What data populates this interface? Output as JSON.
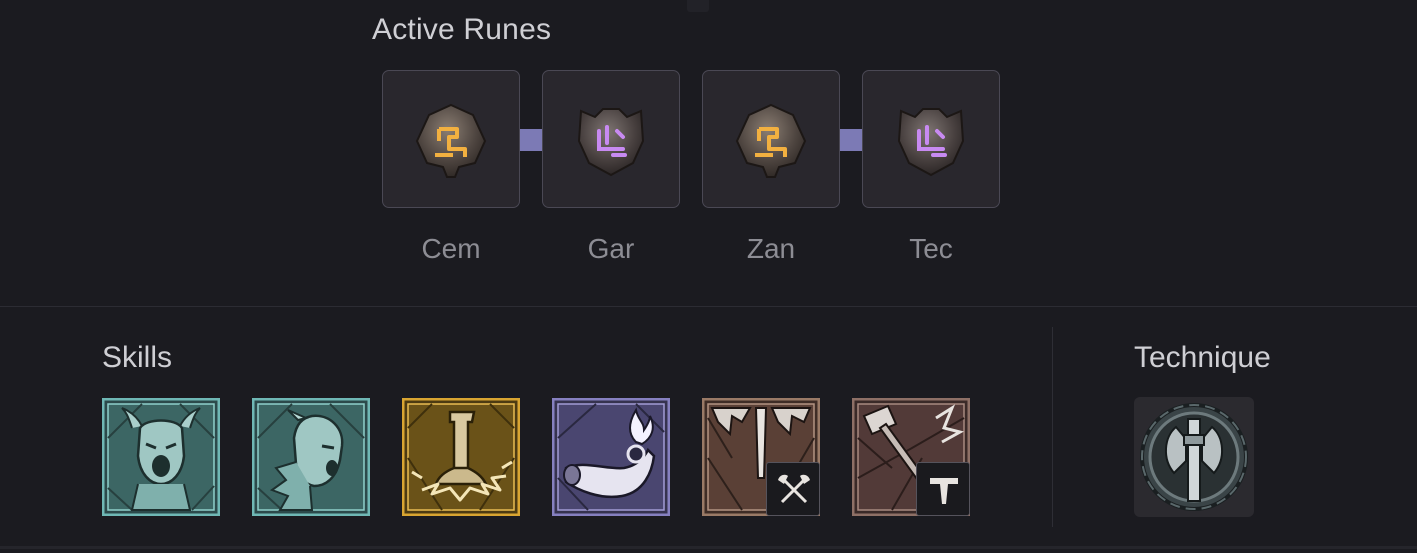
{
  "runes": {
    "title": "Active Runes",
    "slots": [
      {
        "label": "Cem",
        "type": "ritual",
        "glow": "#e8a53a",
        "icon": "rune-cem-icon"
      },
      {
        "label": "Gar",
        "type": "invocation",
        "glow": "#b77ae8",
        "icon": "rune-gar-icon"
      },
      {
        "label": "Zan",
        "type": "ritual",
        "glow": "#e8a53a",
        "icon": "rune-zan-icon"
      },
      {
        "label": "Tec",
        "type": "invocation",
        "glow": "#b77ae8",
        "icon": "rune-tec-icon"
      }
    ],
    "connector_color": "#7c7ab5"
  },
  "skills": {
    "title": "Skills",
    "items": [
      {
        "icon": "war-cry-icon",
        "frame": "teal"
      },
      {
        "icon": "challenging-shout-icon",
        "frame": "teal"
      },
      {
        "icon": "ground-stomp-icon",
        "frame": "gold"
      },
      {
        "icon": "call-of-the-ancients-horn-icon",
        "frame": "purple"
      },
      {
        "icon": "skill-weapon-slam-icon",
        "frame": "bronze",
        "badge": "axe-swap-badge-icon"
      },
      {
        "icon": "skill-hammer-strike-icon",
        "frame": "bronze",
        "badge": "hammer-badge-icon"
      }
    ]
  },
  "technique": {
    "title": "Technique",
    "icon": "two-handed-axe-expertise-icon"
  },
  "colors": {
    "background": "#1b1b20",
    "panel": "#29272d",
    "teal_frame": "#5fa7a5",
    "gold_frame": "#c79a2e",
    "purple_frame": "#7d76b4",
    "bronze_frame": "#8a6a58"
  }
}
